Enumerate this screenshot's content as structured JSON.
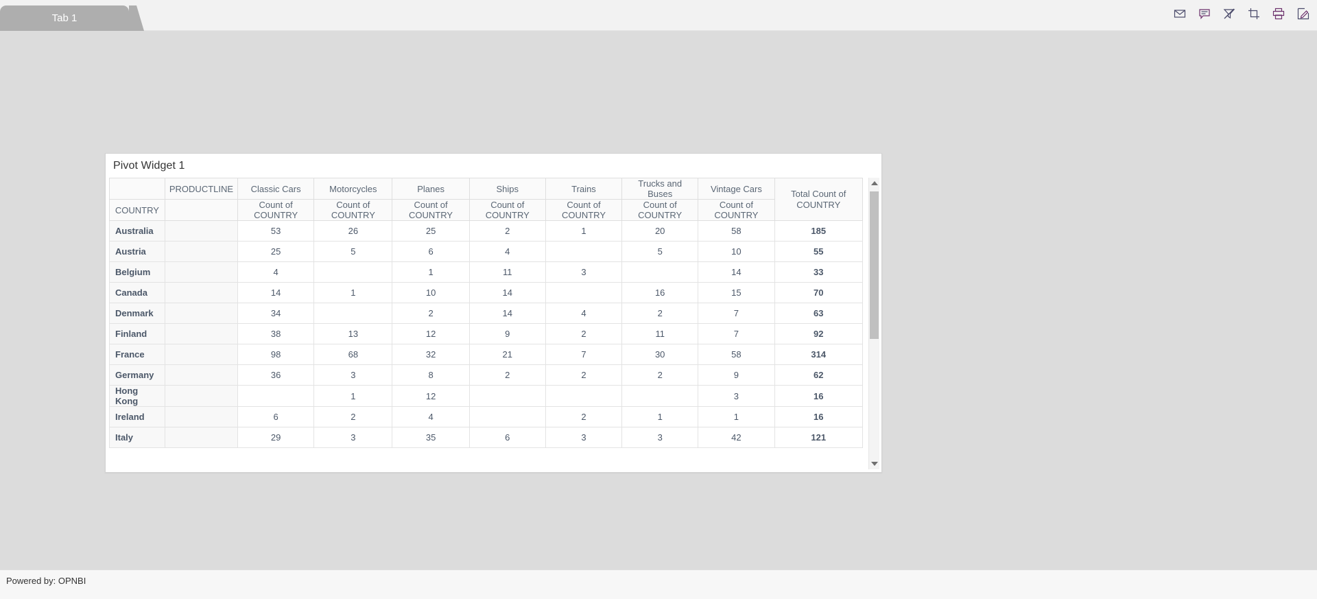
{
  "topbar": {
    "tabs": [
      {
        "label": "Tab 1",
        "active": true
      }
    ],
    "icons": [
      {
        "name": "mail-icon",
        "title": "Send by Mail"
      },
      {
        "name": "comment-icon",
        "title": "Comments"
      },
      {
        "name": "clear-filter-icon",
        "title": "Clear Filters"
      },
      {
        "name": "crop-icon",
        "title": "Crop / Screenshot"
      },
      {
        "name": "print-icon",
        "title": "Print"
      },
      {
        "name": "edit-icon",
        "title": "Edit"
      }
    ]
  },
  "widget": {
    "title": "Pivot Widget 1",
    "scrollbar": {
      "up_arrow": "scroll-up",
      "down_arrow": "scroll-down"
    }
  },
  "chart_data": {
    "type": "table",
    "title": "Pivot Widget 1",
    "row_field": "COUNTRY",
    "column_field": "PRODUCTLINE",
    "measure": "Count of COUNTRY",
    "total_column_label": "Total Count of COUNTRY",
    "column_headers": [
      "Classic Cars",
      "Motorcycles",
      "Planes",
      "Ships",
      "Trains",
      "Trucks and Buses",
      "Vintage Cars"
    ],
    "measure_headers": [
      "Count of COUNTRY",
      "Count of COUNTRY",
      "Count of COUNTRY",
      "Count of COUNTRY",
      "Count of COUNTRY",
      "Count of COUNTRY",
      "Count of COUNTRY"
    ],
    "rows": [
      {
        "country": "Australia",
        "values": [
          "53",
          "26",
          "25",
          "2",
          "1",
          "20",
          "58"
        ],
        "total": "185"
      },
      {
        "country": "Austria",
        "values": [
          "25",
          "5",
          "6",
          "4",
          "",
          "5",
          "10"
        ],
        "total": "55"
      },
      {
        "country": "Belgium",
        "values": [
          "4",
          "",
          "1",
          "11",
          "3",
          "",
          "14"
        ],
        "total": "33"
      },
      {
        "country": "Canada",
        "values": [
          "14",
          "1",
          "10",
          "14",
          "",
          "16",
          "15"
        ],
        "total": "70"
      },
      {
        "country": "Denmark",
        "values": [
          "34",
          "",
          "2",
          "14",
          "4",
          "2",
          "7"
        ],
        "total": "63"
      },
      {
        "country": "Finland",
        "values": [
          "38",
          "13",
          "12",
          "9",
          "2",
          "11",
          "7"
        ],
        "total": "92"
      },
      {
        "country": "France",
        "values": [
          "98",
          "68",
          "32",
          "21",
          "7",
          "30",
          "58"
        ],
        "total": "314"
      },
      {
        "country": "Germany",
        "values": [
          "36",
          "3",
          "8",
          "2",
          "2",
          "2",
          "9"
        ],
        "total": "62"
      },
      {
        "country": "Hong Kong",
        "values": [
          "",
          "1",
          "12",
          "",
          "",
          "",
          "3"
        ],
        "total": "16"
      },
      {
        "country": "Ireland",
        "values": [
          "6",
          "2",
          "4",
          "",
          "2",
          "1",
          "1"
        ],
        "total": "16"
      },
      {
        "country": "Italy",
        "values": [
          "29",
          "3",
          "35",
          "6",
          "3",
          "3",
          "42"
        ],
        "total": "121"
      }
    ]
  },
  "footer": {
    "powered_by": "Powered by: OPNBI"
  }
}
